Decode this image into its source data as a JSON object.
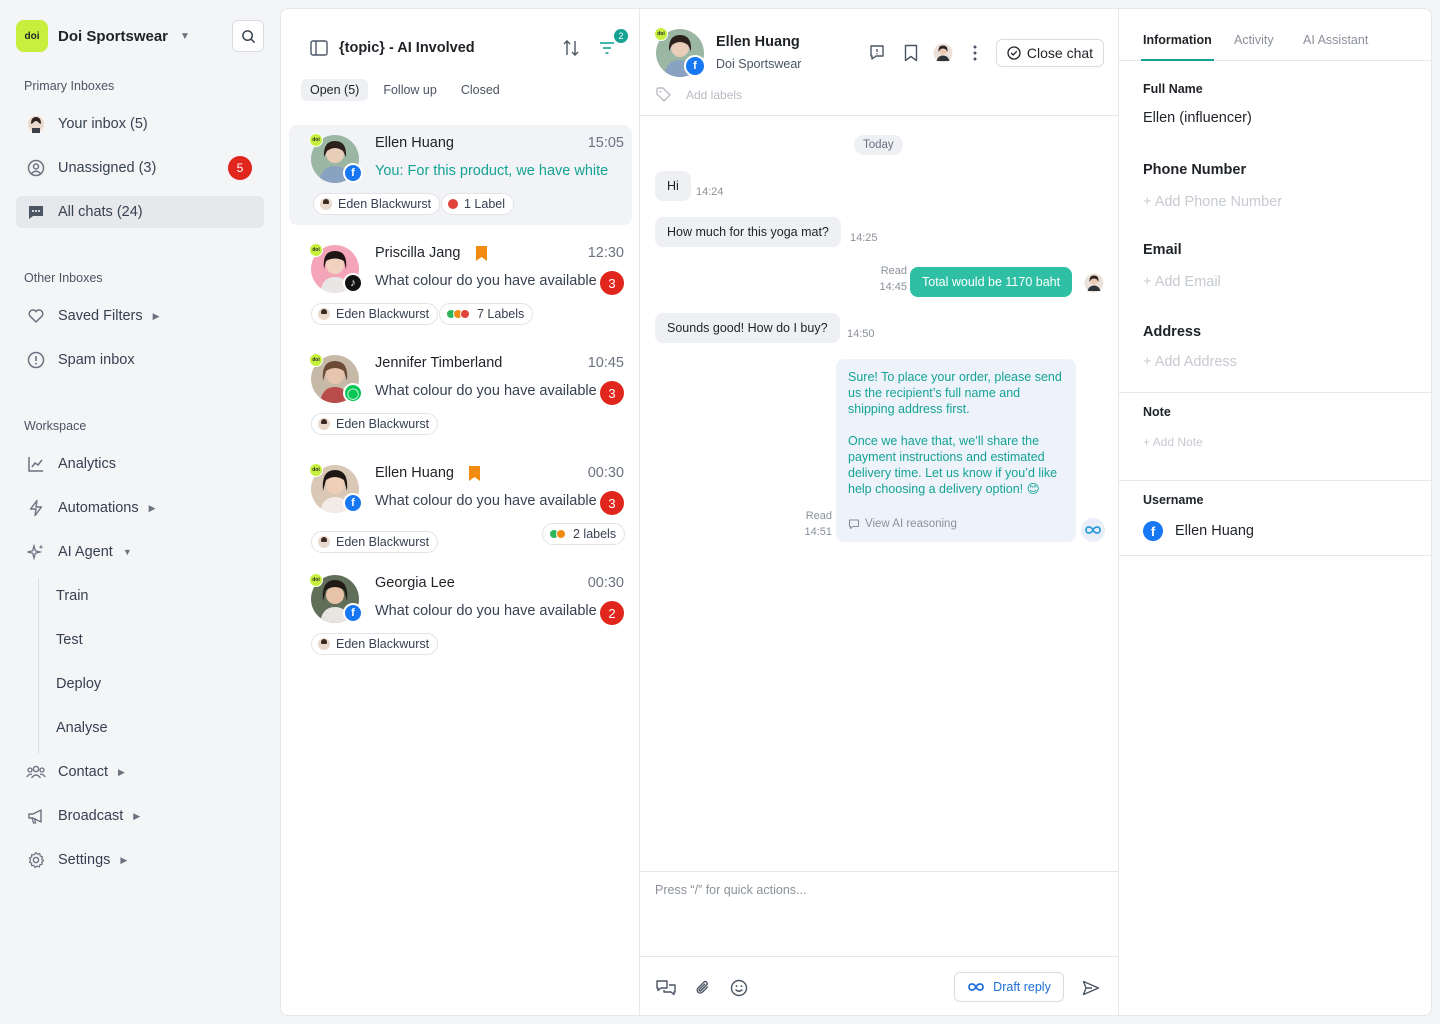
{
  "brand": {
    "name": "Doi Sportswear",
    "logo_text": "doi"
  },
  "sidebar": {
    "primary_title": "Primary Inboxes",
    "your_inbox": "Your inbox (5)",
    "unassigned": "Unassigned (3)",
    "unassigned_badge": "5",
    "all_chats": "All chats (24)",
    "other_title": "Other Inboxes",
    "saved_filters": "Saved Filters",
    "spam_inbox": "Spam inbox",
    "workspace_title": "Workspace",
    "analytics": "Analytics",
    "automations": "Automations",
    "ai_agent": "AI Agent",
    "ai_sub": [
      "Train",
      "Test",
      "Deploy",
      "Analyse"
    ],
    "contact": "Contact",
    "broadcast": "Broadcast",
    "settings": "Settings"
  },
  "list": {
    "title": "{topic} - AI Involved",
    "filter_count": "2",
    "tabs": [
      "Open (5)",
      "Follow up",
      "Closed"
    ],
    "conversations": [
      {
        "name": "Ellen Huang",
        "time": "15:05",
        "message": "You: For this product, we have white",
        "agent": "Eden Blackwurst",
        "label": "1 Label",
        "channel": "facebook"
      },
      {
        "name": "Priscilla Jang",
        "time": "12:30",
        "message": "What colour do you have available",
        "unread": "3",
        "agent": "Eden Blackwurst",
        "label": "7 Labels",
        "channel": "tiktok"
      },
      {
        "name": "Jennifer Timberland",
        "time": "10:45",
        "message": "What colour do you have available",
        "unread": "3",
        "agent": "Eden Blackwurst",
        "channel": "line"
      },
      {
        "name": "Ellen Huang",
        "time": "00:30",
        "message": "What colour do you have available",
        "unread": "3",
        "agent": "Eden Blackwurst",
        "label": "2 labels",
        "channel": "facebook"
      },
      {
        "name": "Georgia Lee",
        "time": "00:30",
        "message": "What colour do you have available",
        "unread": "2",
        "agent": "Eden Blackwurst",
        "channel": "facebook"
      }
    ]
  },
  "chat": {
    "name": "Ellen Huang",
    "subtitle": "Doi Sportswear",
    "add_labels": "Add labels",
    "close_chat": "Close chat",
    "today": "Today",
    "messages": [
      {
        "text": "Hi",
        "time": "14:24"
      },
      {
        "text": "How much for this yoga mat?",
        "time": "14:25"
      },
      {
        "text": "Total would be 1170 baht",
        "status": "Read",
        "time": "14:45"
      },
      {
        "text": "Sounds good! How do I buy?",
        "time": "14:50"
      }
    ],
    "ai_message_p1": "Sure! To place your order, please send us the recipient’s full name and shipping address first.",
    "ai_message_p2": "Once we have that, we’ll share the payment instructions and estimated delivery time. Let us know if you’d like help choosing a delivery option! 😊",
    "ai_status": "Read",
    "ai_time": "14:51",
    "ai_reasoning": "View AI reasoning",
    "composer_placeholder": "Press “/” for quick actions...",
    "draft_reply": "Draft reply"
  },
  "info": {
    "tabs": [
      "Information",
      "Activity",
      "AI Assistant"
    ],
    "full_name_label": "Full Name",
    "full_name": "Ellen (influencer)",
    "phone_label": "Phone Number",
    "phone_add": "+ Add Phone Number",
    "email_label": "Email",
    "email_add": "+ Add Email",
    "address_label": "Address",
    "address_add": "+ Add Address",
    "note_label": "Note",
    "note_add": "+ Add Note",
    "username_label": "Username",
    "username": "Ellen Huang"
  },
  "colors": {
    "accent": "#16a394",
    "outgoing": "#2ebfa5",
    "unread": "#e0261d",
    "brand": "#c6f03c",
    "bookmark": "#f28b12"
  }
}
